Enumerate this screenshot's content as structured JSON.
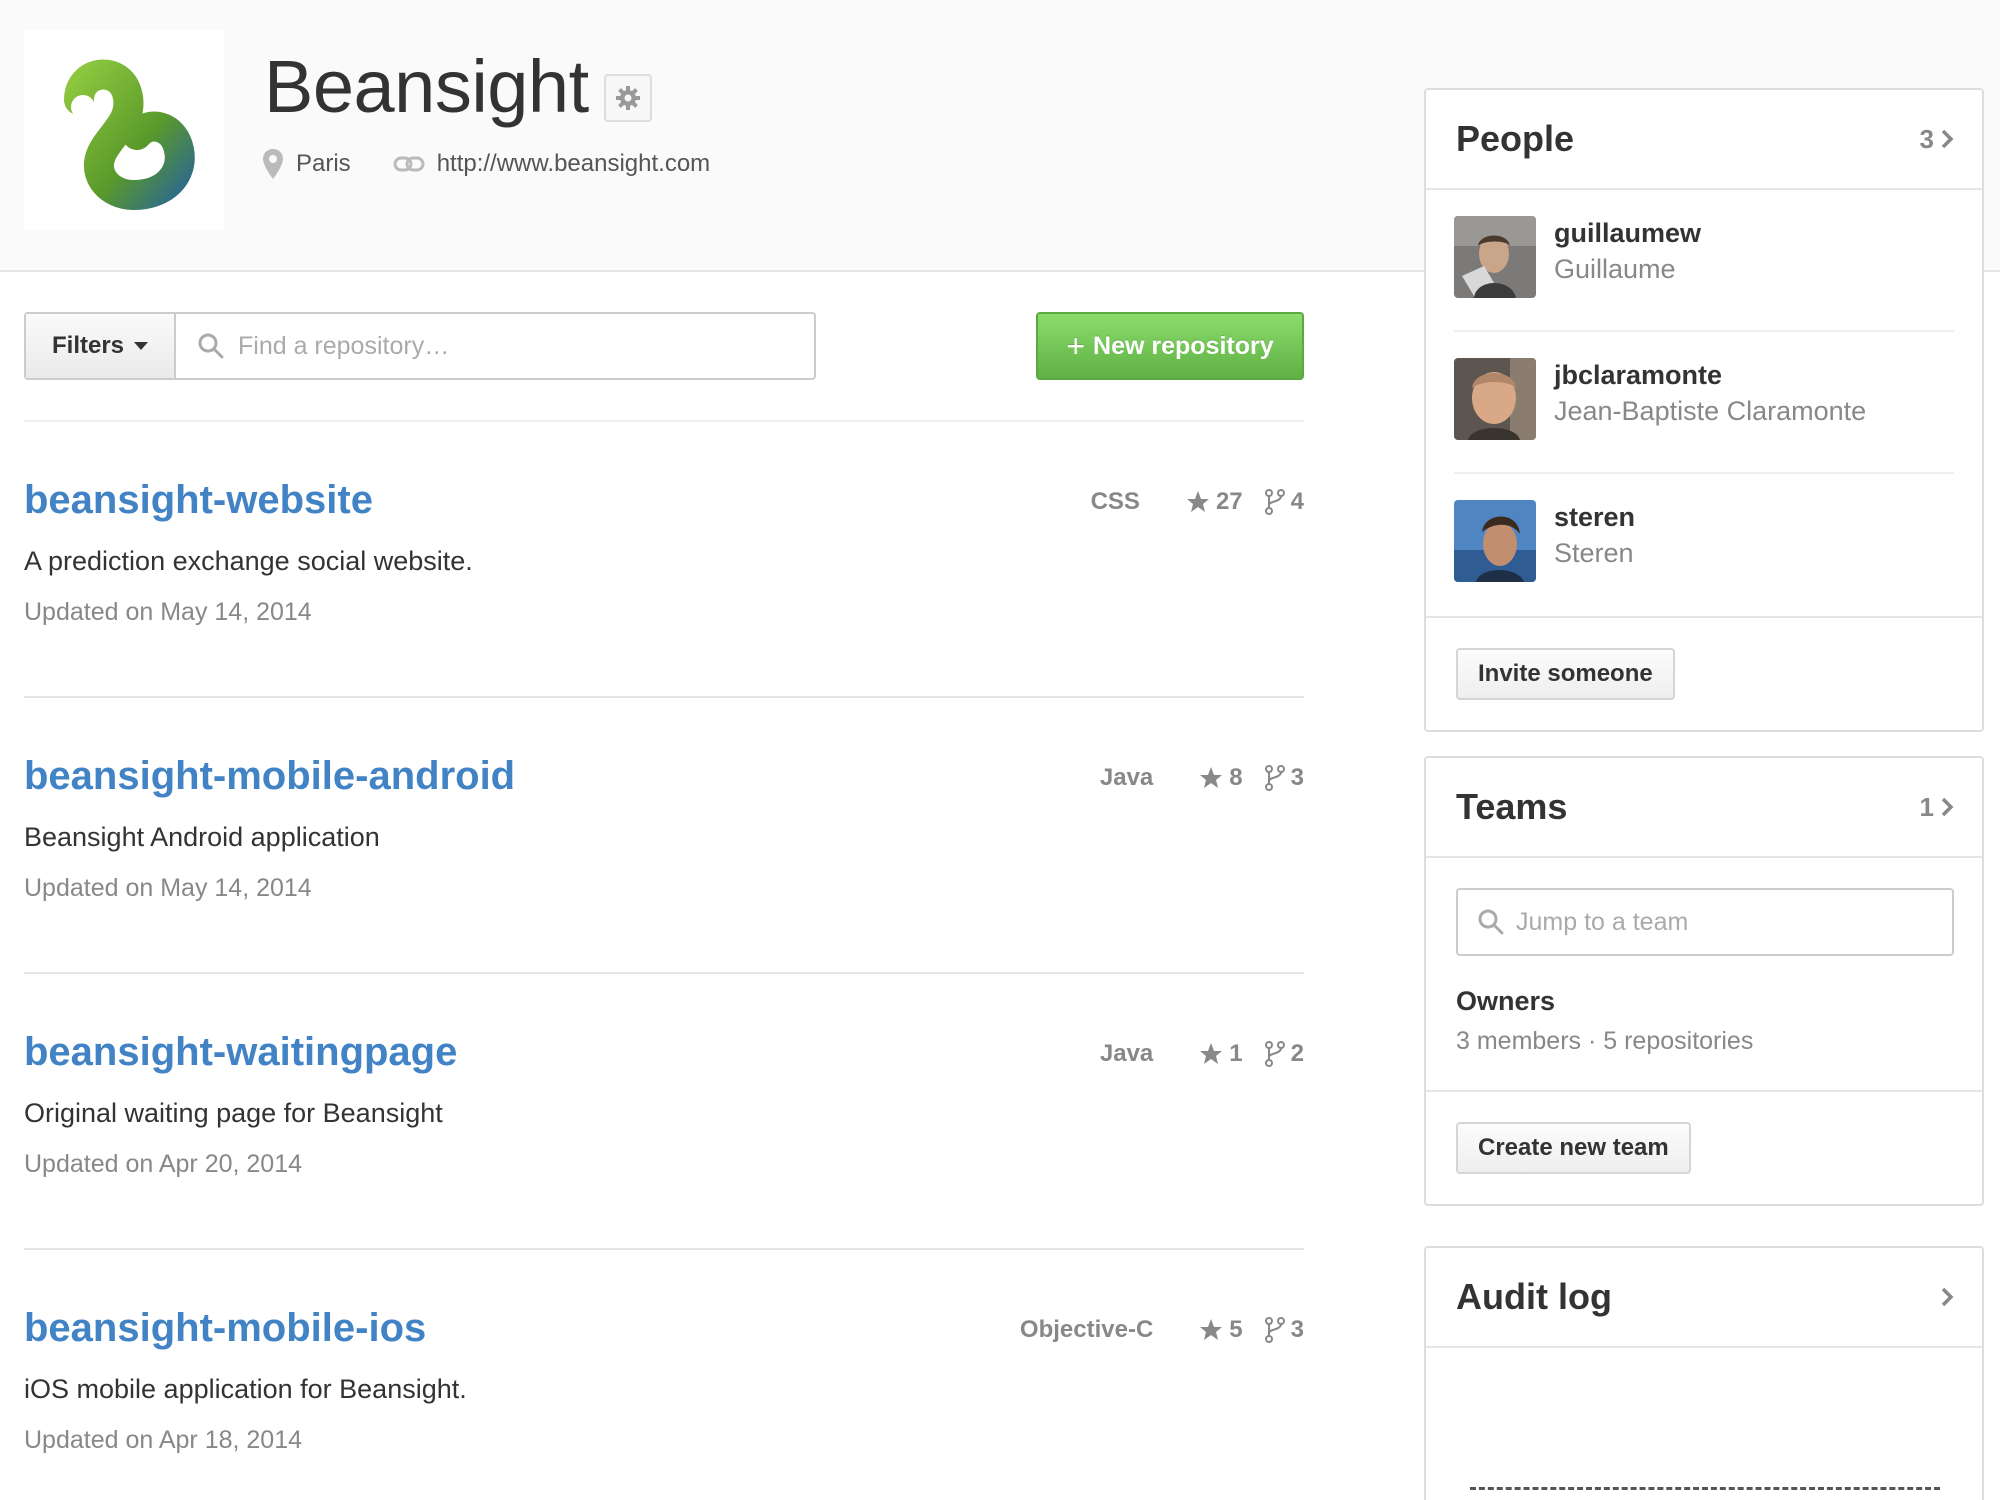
{
  "org": {
    "name": "Beansight",
    "location": "Paris",
    "website": "http://www.beansight.com"
  },
  "toolbar": {
    "filters_label": "Filters",
    "search_placeholder": "Find a repository…",
    "new_repo_label": "New repository"
  },
  "repos": [
    {
      "name": "beansight-website",
      "description": "A prediction exchange social website.",
      "updated": "Updated on May 14, 2014",
      "language": "CSS",
      "stars": "27",
      "forks": "4"
    },
    {
      "name": "beansight-mobile-android",
      "description": "Beansight Android application",
      "updated": "Updated on May 14, 2014",
      "language": "Java",
      "stars": "8",
      "forks": "3"
    },
    {
      "name": "beansight-waitingpage",
      "description": "Original waiting page for Beansight",
      "updated": "Updated on Apr 20, 2014",
      "language": "Java",
      "stars": "1",
      "forks": "2"
    },
    {
      "name": "beansight-mobile-ios",
      "description": "iOS mobile application for Beansight.",
      "updated": "Updated on Apr 18, 2014",
      "language": "Objective-C",
      "stars": "5",
      "forks": "3"
    }
  ],
  "people": {
    "title": "People",
    "count": "3",
    "members": [
      {
        "login": "guillaumew",
        "name": "Guillaume"
      },
      {
        "login": "jbclaramonte",
        "name": "Jean-Baptiste Claramonte"
      },
      {
        "login": "steren",
        "name": "Steren"
      }
    ],
    "invite_label": "Invite someone"
  },
  "teams": {
    "title": "Teams",
    "count": "1",
    "search_placeholder": "Jump to a team",
    "items": [
      {
        "name": "Owners",
        "meta": "3 members · 5 repositories"
      }
    ],
    "create_label": "Create new team"
  },
  "audit": {
    "title": "Audit log"
  },
  "colors": {
    "link": "#4183c4",
    "primary_button": "#6cc644",
    "logo_green": "#6aa631"
  }
}
